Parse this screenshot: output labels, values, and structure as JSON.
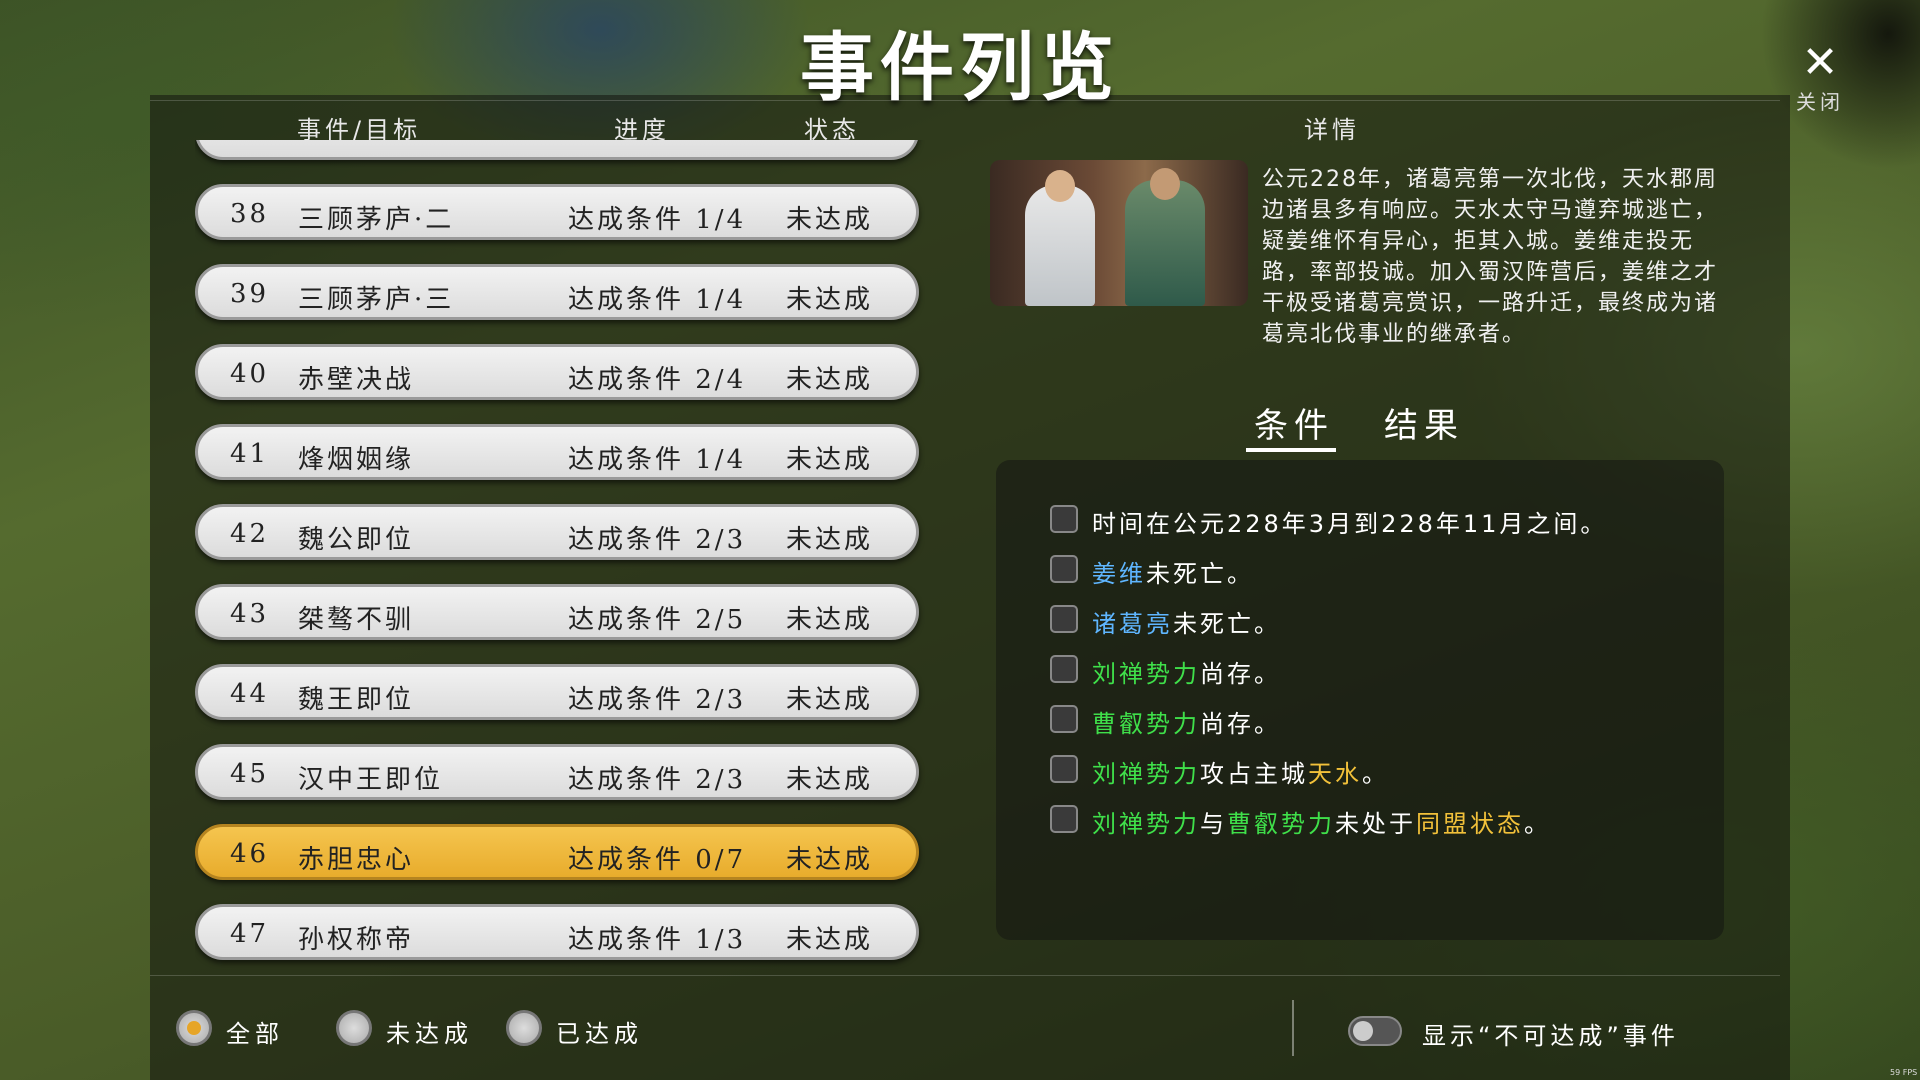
{
  "header": {
    "title": "事件列览",
    "close_label": "关闭",
    "close_icon": "✕"
  },
  "columns": {
    "event": "事件/目标",
    "progress": "进度",
    "status": "状态",
    "detail": "详情"
  },
  "events": [
    {
      "num": "38",
      "name": "三顾茅庐·二",
      "progress": "达成条件 1/4",
      "status": "未达成"
    },
    {
      "num": "39",
      "name": "三顾茅庐·三",
      "progress": "达成条件 1/4",
      "status": "未达成"
    },
    {
      "num": "40",
      "name": "赤壁决战",
      "progress": "达成条件 2/4",
      "status": "未达成"
    },
    {
      "num": "41",
      "name": "烽烟姻缘",
      "progress": "达成条件 1/4",
      "status": "未达成"
    },
    {
      "num": "42",
      "name": "魏公即位",
      "progress": "达成条件 2/3",
      "status": "未达成"
    },
    {
      "num": "43",
      "name": "桀骜不驯",
      "progress": "达成条件 2/5",
      "status": "未达成"
    },
    {
      "num": "44",
      "name": "魏王即位",
      "progress": "达成条件 2/3",
      "status": "未达成"
    },
    {
      "num": "45",
      "name": "汉中王即位",
      "progress": "达成条件 2/3",
      "status": "未达成"
    },
    {
      "num": "46",
      "name": "赤胆忠心",
      "progress": "达成条件 0/7",
      "status": "未达成",
      "selected": true
    },
    {
      "num": "47",
      "name": "孙权称帝",
      "progress": "达成条件 1/3",
      "status": "未达成"
    }
  ],
  "detail": {
    "description": "公元228年，诸葛亮第一次北伐，天水郡周边诸县多有响应。天水太守马遵弃城逃亡，疑姜维怀有异心，拒其入城。姜维走投无路，率部投诚。加入蜀汉阵营后，姜维之才干极受诸葛亮赏识，一路升迁，最终成为诸葛亮北伐事业的继承者。",
    "tab_conditions": "条件",
    "tab_results": "结果",
    "conditions": [
      {
        "parts": [
          {
            "t": "时间在公元228年3月到228年11月之间。",
            "c": ""
          }
        ]
      },
      {
        "parts": [
          {
            "t": "姜维",
            "c": "blue"
          },
          {
            "t": "未死亡。",
            "c": ""
          }
        ]
      },
      {
        "parts": [
          {
            "t": "诸葛亮",
            "c": "blue"
          },
          {
            "t": "未死亡。",
            "c": ""
          }
        ]
      },
      {
        "parts": [
          {
            "t": "刘禅势力",
            "c": "green"
          },
          {
            "t": "尚存。",
            "c": ""
          }
        ]
      },
      {
        "parts": [
          {
            "t": "曹叡势力",
            "c": "green"
          },
          {
            "t": "尚存。",
            "c": ""
          }
        ]
      },
      {
        "parts": [
          {
            "t": "刘禅势力",
            "c": "green"
          },
          {
            "t": "攻占主城",
            "c": ""
          },
          {
            "t": "天水",
            "c": "yellow"
          },
          {
            "t": "。",
            "c": ""
          }
        ]
      },
      {
        "parts": [
          {
            "t": "刘禅势力",
            "c": "green"
          },
          {
            "t": "与",
            "c": ""
          },
          {
            "t": "曹叡势力",
            "c": "green"
          },
          {
            "t": "未处于",
            "c": ""
          },
          {
            "t": "同盟状态",
            "c": "yellow"
          },
          {
            "t": "。",
            "c": ""
          }
        ]
      }
    ]
  },
  "filters": [
    {
      "label": "全部",
      "selected": true
    },
    {
      "label": "未达成",
      "selected": false
    },
    {
      "label": "已达成",
      "selected": false
    }
  ],
  "toggle": {
    "label": "显示“不可达成”事件",
    "on": false
  },
  "fps": "59 FPS",
  "colors": {
    "selected_row": "#f0b83a",
    "blue_name": "#5fb6ff",
    "green_faction": "#3fe04a",
    "yellow_place": "#f2c13a"
  }
}
